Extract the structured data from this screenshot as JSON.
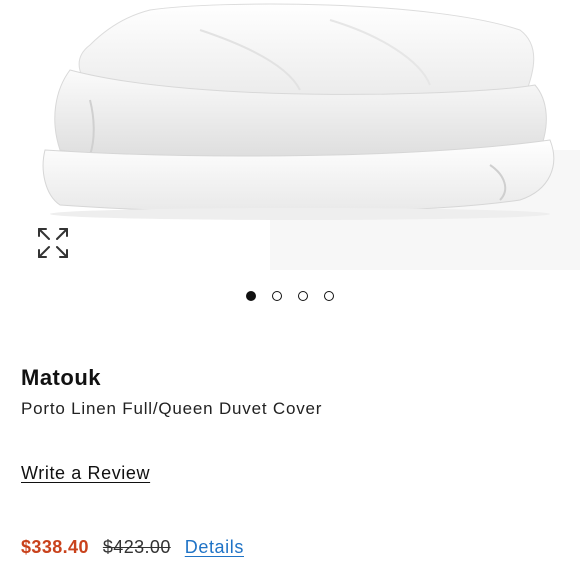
{
  "gallery": {
    "image_icon": "folded-white-duvet-image",
    "expand_icon": "expand-arrows-icon",
    "slide_count": 4,
    "active_slide": 1
  },
  "product": {
    "brand": "Matouk",
    "name": "Porto Linen Full/Queen Duvet Cover",
    "review_link": "Write a Review"
  },
  "pricing": {
    "sale_price": "$338.40",
    "original_price": "$423.00",
    "details_link": "Details",
    "sale_color": "#c9421c",
    "link_color": "#1f73c6"
  }
}
